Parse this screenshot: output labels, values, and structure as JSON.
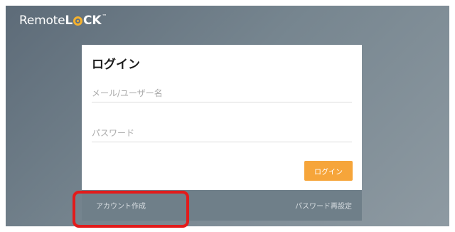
{
  "brand": {
    "name_part1": "Remote",
    "name_part2_l": "L",
    "name_part2_rest": "CK",
    "trademark": "™"
  },
  "login_form": {
    "title": "ログイン",
    "username_placeholder": "メール/ユーザー名",
    "password_placeholder": "パスワード",
    "submit_label": "ログイン"
  },
  "footer": {
    "create_account_label": "アカウント作成",
    "reset_password_label": "パスワード再設定"
  },
  "colors": {
    "accent": "#f6a53a",
    "highlight": "#e21b1b",
    "logo_accent": "#f6b22d"
  }
}
